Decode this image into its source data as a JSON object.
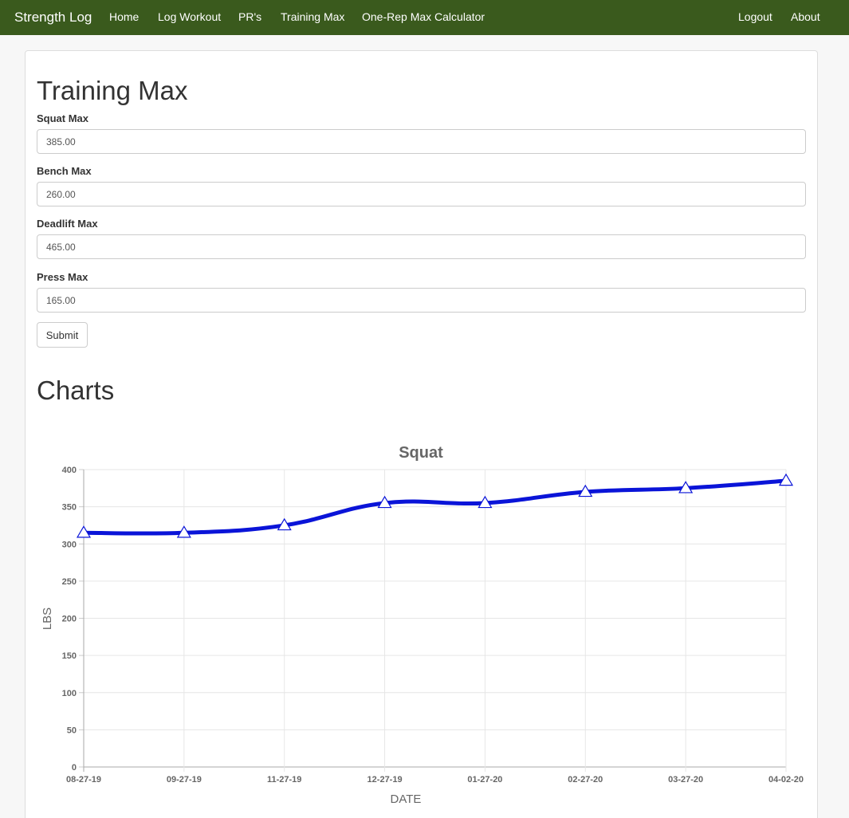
{
  "navbar": {
    "brand": "Strength Log",
    "links": [
      "Home",
      "Log Workout",
      "PR's",
      "Training Max",
      "One-Rep Max Calculator"
    ],
    "right_links": [
      "Logout",
      "About"
    ],
    "bg_color": "#3a5a1d"
  },
  "training_max": {
    "heading": "Training Max",
    "fields": [
      {
        "label": "Squat Max",
        "value": "385.00"
      },
      {
        "label": "Bench Max",
        "value": "260.00"
      },
      {
        "label": "Deadlift Max",
        "value": "465.00"
      },
      {
        "label": "Press Max",
        "value": "165.00"
      }
    ],
    "submit_label": "Submit"
  },
  "charts_heading": "Charts",
  "chart_data": {
    "type": "line",
    "title": "Squat",
    "xlabel": "DATE",
    "ylabel": "LBS",
    "categories": [
      "08-27-19",
      "09-27-19",
      "11-27-19",
      "12-27-19",
      "01-27-20",
      "02-27-20",
      "03-27-20",
      "04-02-20"
    ],
    "values": [
      315,
      315,
      325,
      355,
      355,
      370,
      375,
      385
    ],
    "ylim": [
      0,
      400
    ],
    "yticks": [
      0,
      50,
      100,
      150,
      200,
      250,
      300,
      350,
      400
    ],
    "grid": true,
    "line_color": "#0a14d8",
    "marker": "triangle"
  }
}
